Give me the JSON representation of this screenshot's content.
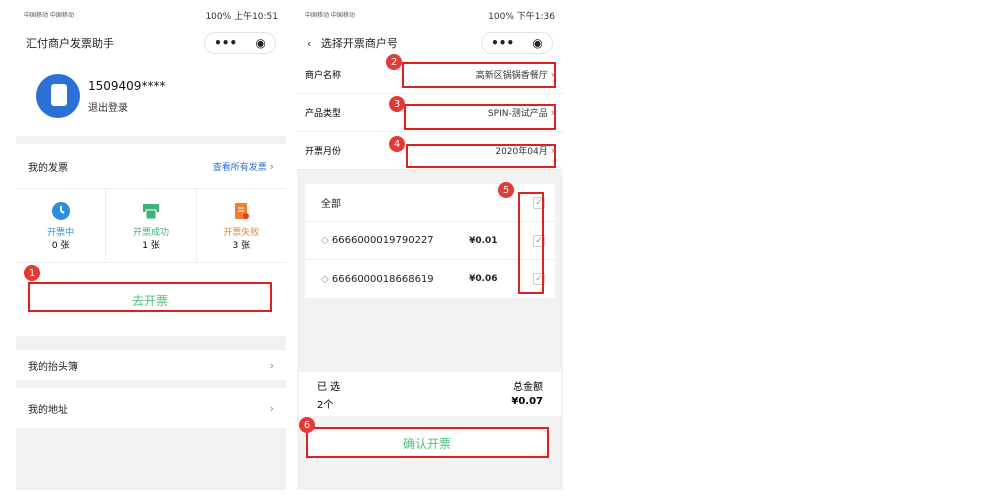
{
  "left": {
    "status": {
      "carrier": "中国移动 中国移动",
      "battery": "100%",
      "time": "上午10:51"
    },
    "title": "汇付商户发票助手",
    "menu_icon": "•••",
    "user": {
      "phone": "1509409****",
      "logout": "退出登录"
    },
    "invoices": {
      "label": "我的发票",
      "view_all": "查看所有发票",
      "stats": [
        {
          "label": "开票中",
          "count": "0 张",
          "color": "#2b8ee0"
        },
        {
          "label": "开票成功",
          "count": "1 张",
          "color": "#3cb37a"
        },
        {
          "label": "开票失败",
          "count": "3 张",
          "color": "#f08030"
        }
      ]
    },
    "go_invoice": "去开票",
    "header_book": "我的抬头簿",
    "address": "我的地址",
    "badge": "1"
  },
  "right": {
    "status": {
      "carrier": "中国移动 中国移动",
      "battery": "100%",
      "time": "下午1:36"
    },
    "title": "选择开票商户号",
    "menu_icon": "•••",
    "fields": [
      {
        "label": "商户名称",
        "value": "高新区锅锅香餐厅"
      },
      {
        "label": "产品类型",
        "value": "SPIN-测试产品"
      },
      {
        "label": "开票月份",
        "value": "2020年04月"
      }
    ],
    "all": "全部",
    "orders": [
      {
        "id": "6666000019790227",
        "amount": "¥0.01"
      },
      {
        "id": "6666000018668619",
        "amount": "¥0.06"
      }
    ],
    "summary": {
      "selected_label": "已 选",
      "selected_value": "2个",
      "total_label": "总金额",
      "total_value": "¥0.07"
    },
    "confirm": "确认开票",
    "badges": [
      "2",
      "3",
      "4",
      "5",
      "6"
    ]
  }
}
